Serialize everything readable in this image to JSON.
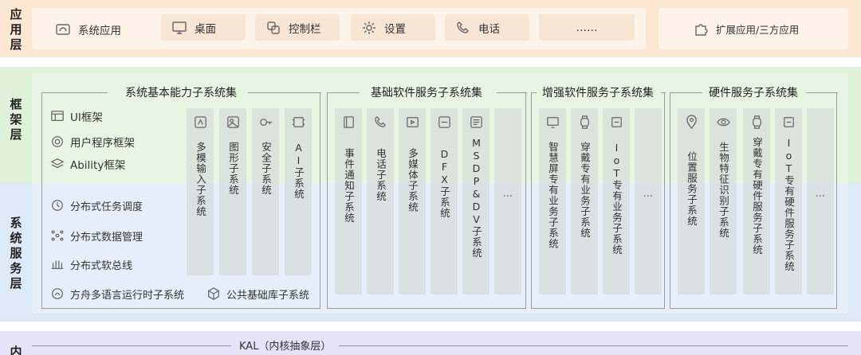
{
  "layers": {
    "app": [
      "应",
      "用",
      "层"
    ],
    "framework": [
      "框",
      "架",
      "层"
    ],
    "system_service": [
      "系",
      "统",
      "服",
      "务",
      "层"
    ],
    "kernel": [
      "内"
    ]
  },
  "app_layer": {
    "items": [
      "系统应用",
      "桌面",
      "控制栏",
      "设置",
      "电话",
      "……"
    ],
    "extension": "扩展应用/三方应用"
  },
  "framework_items": [
    "UI框架",
    "用户程序框架",
    "Ability框架"
  ],
  "system_items": [
    "分布式任务调度",
    "分布式数据管理",
    "分布式软总线"
  ],
  "bottom_items": [
    "方舟多语言运行时子系统",
    "公共基础库子系统"
  ],
  "groups": {
    "basic": {
      "title": "系统基本能力子系统集",
      "columns": [
        "多模输入子系统",
        "图形子系统",
        "安全子系统",
        "AI子系统"
      ]
    },
    "software": {
      "title": "基础软件服务子系统集",
      "columns": [
        "事件通知子系统",
        "电话子系统",
        "多媒体子系统",
        "DFX子系统",
        "MSDP&DV子系统",
        "⋮"
      ]
    },
    "enhanced": {
      "title": "增强软件服务子系统集",
      "columns": [
        "智慧屏专有业务子系统",
        "穿戴专有业务子系统",
        "IoT专有业务子系统",
        "⋮"
      ]
    },
    "hardware": {
      "title": "硬件服务子系统集",
      "columns": [
        "位置服务子系统",
        "生物特征识别子系统",
        "穿戴专有硬件服务子系统",
        "IoT专有硬件服务子系统",
        "⋮"
      ]
    }
  },
  "kernel": {
    "kal": "KAL（内核抽象层）"
  }
}
